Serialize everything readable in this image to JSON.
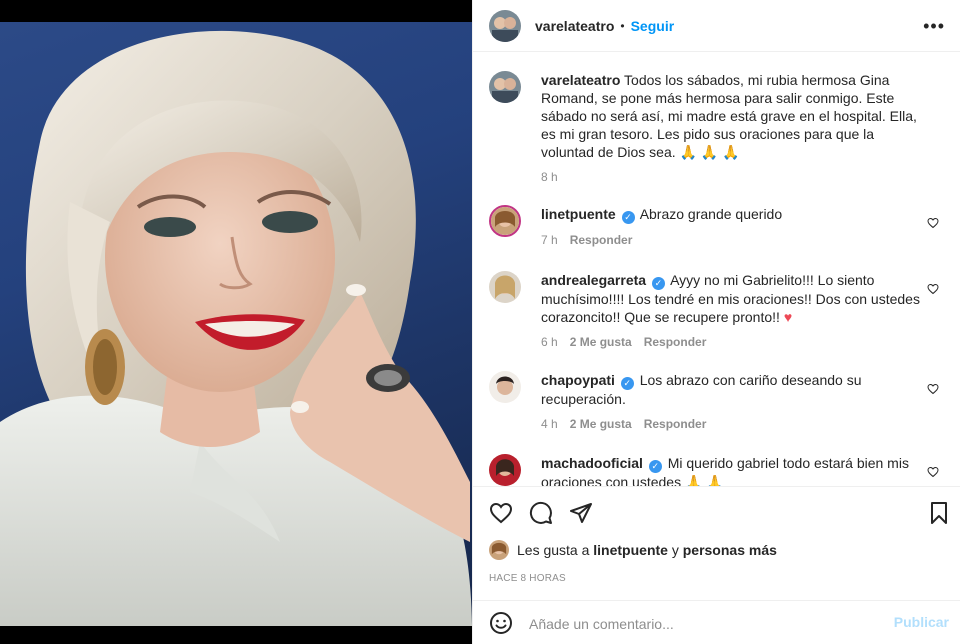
{
  "post": {
    "username": "varelateatro",
    "follow_label": "Seguir",
    "more_icon": "more-horizontal-icon",
    "separator": "•"
  },
  "caption": {
    "username": "varelateatro",
    "text": "Todos los sábados, mi rubia hermosa Gina Romand, se pone más hermosa para salir conmigo. Este sábado no será así, mi madre está grave en el hospital. Ella, es mi gran tesoro. Les pido sus oraciones para que la voluntad de Dios sea. 🙏 🙏 🙏",
    "time": "8 h"
  },
  "comments": [
    {
      "username": "linetpuente",
      "verified": true,
      "text": "Abrazo grande querido",
      "time": "7 h",
      "likes": "",
      "reply": "Responder"
    },
    {
      "username": "andrealegarreta",
      "verified": true,
      "text": "Ayyy no mi Gabrielito!!! Lo siento muchísimo!!!! Los tendré en mis oraciones!! Dos con ustedes corazoncito!! Que se recupere pronto!!",
      "heart": "♥",
      "time": "6 h",
      "likes": "2 Me gusta",
      "reply": "Responder"
    },
    {
      "username": "chapoypati",
      "verified": true,
      "text": "Los abrazo con cariño deseando su recuperación.",
      "time": "4 h",
      "likes": "2 Me gusta",
      "reply": "Responder"
    },
    {
      "username": "machadooficial",
      "verified": true,
      "text": "Mi querido gabriel todo estará bien mis oraciones con ustedes 🙏 🙏",
      "time": "",
      "likes": "",
      "reply": ""
    }
  ],
  "actions": {
    "like_icon": "heart-icon",
    "comment_icon": "comment-icon",
    "share_icon": "share-icon",
    "save_icon": "bookmark-icon"
  },
  "likes": {
    "prefix": "Les gusta a",
    "user": "linetpuente",
    "conj": "y",
    "rest": "personas más"
  },
  "time_ago": "HACE 8 HORAS",
  "add_comment": {
    "placeholder": "Añade un comentario...",
    "publish": "Publicar",
    "emoji_icon": "smiley-icon"
  },
  "colors": {
    "accent": "#0095f6",
    "verified": "#3897f0",
    "heart": "#ed4956",
    "muted": "#8e8e8e",
    "publish_disabled": "#b2dffc"
  }
}
